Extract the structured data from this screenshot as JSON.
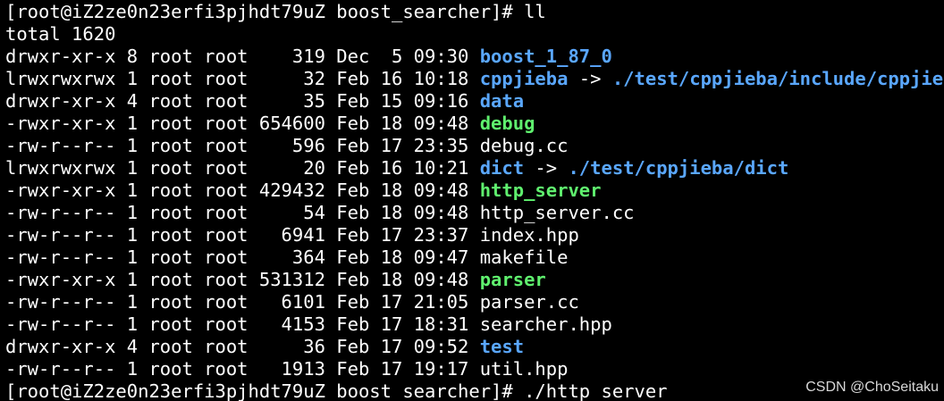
{
  "colors": {
    "background": "#000000",
    "text": "#ffffff",
    "directory": "#5aa7ff",
    "symlink": "#5aa7ff",
    "executable": "#5ff06e"
  },
  "prompt1": "[root@iZ2ze0n23erfi3pjhdt79uZ boost_searcher]# ",
  "command1": "ll",
  "total": "total 1620",
  "entries": [
    {
      "meta": "drwxr-xr-x 8 root root    319 Dec  5 09:30 ",
      "name": "boost_1_87_0",
      "kind": "dir",
      "arrow": "",
      "target": ""
    },
    {
      "meta": "lrwxrwxrwx 1 root root     32 Feb 16 10:18 ",
      "name": "cppjieba",
      "kind": "link",
      "arrow": " -> ",
      "target": "./test/cppjieba/include/cppjieba"
    },
    {
      "meta": "drwxr-xr-x 4 root root     35 Feb 15 09:16 ",
      "name": "data",
      "kind": "dir",
      "arrow": "",
      "target": ""
    },
    {
      "meta": "-rwxr-xr-x 1 root root 654600 Feb 18 09:48 ",
      "name": "debug",
      "kind": "exec",
      "arrow": "",
      "target": ""
    },
    {
      "meta": "-rw-r--r-- 1 root root    596 Feb 17 23:35 ",
      "name": "debug.cc",
      "kind": "file",
      "arrow": "",
      "target": ""
    },
    {
      "meta": "lrwxrwxrwx 1 root root     20 Feb 16 10:21 ",
      "name": "dict",
      "kind": "link",
      "arrow": " -> ",
      "target": "./test/cppjieba/dict"
    },
    {
      "meta": "-rwxr-xr-x 1 root root 429432 Feb 18 09:48 ",
      "name": "http_server",
      "kind": "exec",
      "arrow": "",
      "target": ""
    },
    {
      "meta": "-rw-r--r-- 1 root root     54 Feb 18 09:48 ",
      "name": "http_server.cc",
      "kind": "file",
      "arrow": "",
      "target": ""
    },
    {
      "meta": "-rw-r--r-- 1 root root   6941 Feb 17 23:37 ",
      "name": "index.hpp",
      "kind": "file",
      "arrow": "",
      "target": ""
    },
    {
      "meta": "-rw-r--r-- 1 root root    364 Feb 18 09:47 ",
      "name": "makefile",
      "kind": "file",
      "arrow": "",
      "target": ""
    },
    {
      "meta": "-rwxr-xr-x 1 root root 531312 Feb 18 09:48 ",
      "name": "parser",
      "kind": "exec",
      "arrow": "",
      "target": ""
    },
    {
      "meta": "-rw-r--r-- 1 root root   6101 Feb 17 21:05 ",
      "name": "parser.cc",
      "kind": "file",
      "arrow": "",
      "target": ""
    },
    {
      "meta": "-rw-r--r-- 1 root root   4153 Feb 17 18:31 ",
      "name": "searcher.hpp",
      "kind": "file",
      "arrow": "",
      "target": ""
    },
    {
      "meta": "drwxr-xr-x 4 root root     36 Feb 17 09:52 ",
      "name": "test",
      "kind": "dir",
      "arrow": "",
      "target": ""
    },
    {
      "meta": "-rw-r--r-- 1 root root   1913 Feb 17 19:17 ",
      "name": "util.hpp",
      "kind": "file",
      "arrow": "",
      "target": ""
    }
  ],
  "prompt2": "[root@iZ2ze0n23erfi3pjhdt79uZ boost_searcher]# ",
  "command2": "./http_server",
  "watermark": "CSDN @ChoSeitaku"
}
